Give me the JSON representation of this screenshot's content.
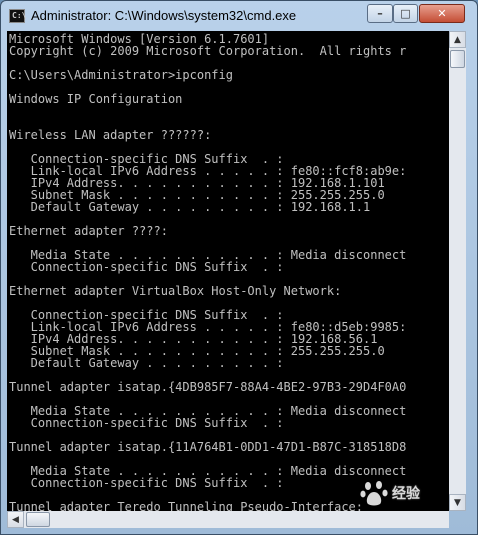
{
  "window": {
    "title": "Administrator: C:\\Windows\\system32\\cmd.exe",
    "icon_label": "C:\\",
    "controls": {
      "minimize": "minimize-icon",
      "maximize": "maximize-icon",
      "close": "close-icon"
    }
  },
  "console": {
    "lines": [
      "Microsoft Windows [Version 6.1.7601]",
      "Copyright (c) 2009 Microsoft Corporation.  All rights r",
      "",
      "C:\\Users\\Administrator>ipconfig",
      "",
      "Windows IP Configuration",
      "",
      "",
      "Wireless LAN adapter ??????:",
      "",
      "   Connection-specific DNS Suffix  . :",
      "   Link-local IPv6 Address . . . . . : fe80::fcf8:ab9e:",
      "   IPv4 Address. . . . . . . . . . . : 192.168.1.101",
      "   Subnet Mask . . . . . . . . . . . : 255.255.255.0",
      "   Default Gateway . . . . . . . . . : 192.168.1.1",
      "",
      "Ethernet adapter ????:",
      "",
      "   Media State . . . . . . . . . . . : Media disconnect",
      "   Connection-specific DNS Suffix  . :",
      "",
      "Ethernet adapter VirtualBox Host-Only Network:",
      "",
      "   Connection-specific DNS Suffix  . :",
      "   Link-local IPv6 Address . . . . . : fe80::d5eb:9985:",
      "   IPv4 Address. . . . . . . . . . . : 192.168.56.1",
      "   Subnet Mask . . . . . . . . . . . : 255.255.255.0",
      "   Default Gateway . . . . . . . . . :",
      "",
      "Tunnel adapter isatap.{4DB985F7-88A4-4BE2-97B3-29D4F0A0",
      "",
      "   Media State . . . . . . . . . . . : Media disconnect",
      "   Connection-specific DNS Suffix  . :",
      "",
      "Tunnel adapter isatap.{11A764B1-0DD1-47D1-B87C-318518D8",
      "",
      "   Media State . . . . . . . . . . . : Media disconnect",
      "   Connection-specific DNS Suffix  . :",
      "",
      "Tunnel adapter Teredo Tunneling Pseudo-Interface:"
    ]
  },
  "scrollbar": {
    "up_icon": "arrow-up-icon",
    "down_icon": "arrow-down-icon",
    "left_icon": "arrow-left-icon"
  },
  "watermark": {
    "text": "经验"
  }
}
